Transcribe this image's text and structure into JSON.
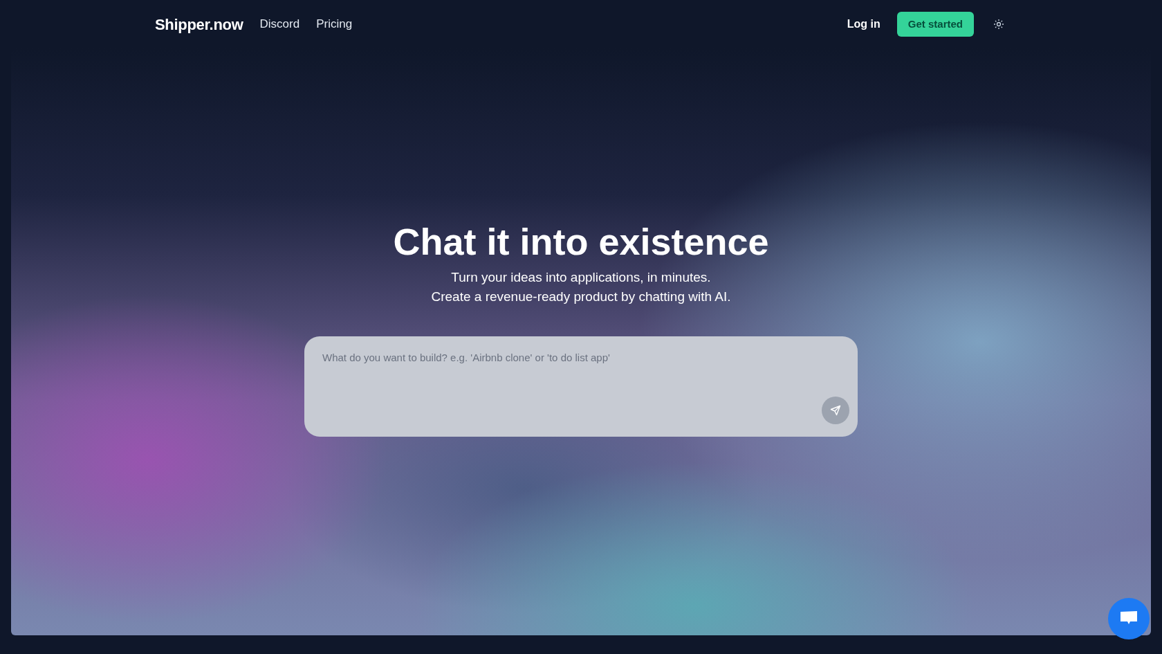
{
  "navbar": {
    "logo": "Shipper.now",
    "links": [
      "Discord",
      "Pricing"
    ],
    "login": "Log in",
    "cta": "Get started"
  },
  "hero": {
    "title": "Chat it into existence",
    "subtitle_lines": [
      "Turn your ideas into applications, in minutes.",
      "Create a revenue-ready product by chatting with AI."
    ],
    "prompt": {
      "placeholder": "What do you want to build? e.g. 'Airbnb clone' or 'to do list app'"
    }
  }
}
